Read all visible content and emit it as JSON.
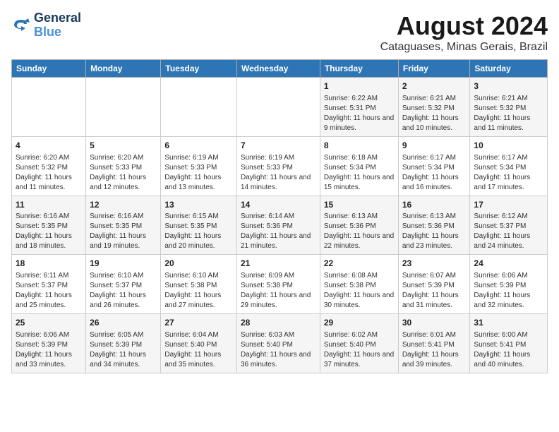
{
  "header": {
    "logo_line1": "General",
    "logo_line2": "Blue",
    "title": "August 2024",
    "subtitle": "Cataguases, Minas Gerais, Brazil"
  },
  "days_of_week": [
    "Sunday",
    "Monday",
    "Tuesday",
    "Wednesday",
    "Thursday",
    "Friday",
    "Saturday"
  ],
  "weeks": [
    [
      {
        "day": "",
        "info": ""
      },
      {
        "day": "",
        "info": ""
      },
      {
        "day": "",
        "info": ""
      },
      {
        "day": "",
        "info": ""
      },
      {
        "day": "1",
        "info": "Sunrise: 6:22 AM\nSunset: 5:31 PM\nDaylight: 11 hours and 9 minutes."
      },
      {
        "day": "2",
        "info": "Sunrise: 6:21 AM\nSunset: 5:32 PM\nDaylight: 11 hours and 10 minutes."
      },
      {
        "day": "3",
        "info": "Sunrise: 6:21 AM\nSunset: 5:32 PM\nDaylight: 11 hours and 11 minutes."
      }
    ],
    [
      {
        "day": "4",
        "info": "Sunrise: 6:20 AM\nSunset: 5:32 PM\nDaylight: 11 hours and 11 minutes."
      },
      {
        "day": "5",
        "info": "Sunrise: 6:20 AM\nSunset: 5:33 PM\nDaylight: 11 hours and 12 minutes."
      },
      {
        "day": "6",
        "info": "Sunrise: 6:19 AM\nSunset: 5:33 PM\nDaylight: 11 hours and 13 minutes."
      },
      {
        "day": "7",
        "info": "Sunrise: 6:19 AM\nSunset: 5:33 PM\nDaylight: 11 hours and 14 minutes."
      },
      {
        "day": "8",
        "info": "Sunrise: 6:18 AM\nSunset: 5:34 PM\nDaylight: 11 hours and 15 minutes."
      },
      {
        "day": "9",
        "info": "Sunrise: 6:17 AM\nSunset: 5:34 PM\nDaylight: 11 hours and 16 minutes."
      },
      {
        "day": "10",
        "info": "Sunrise: 6:17 AM\nSunset: 5:34 PM\nDaylight: 11 hours and 17 minutes."
      }
    ],
    [
      {
        "day": "11",
        "info": "Sunrise: 6:16 AM\nSunset: 5:35 PM\nDaylight: 11 hours and 18 minutes."
      },
      {
        "day": "12",
        "info": "Sunrise: 6:16 AM\nSunset: 5:35 PM\nDaylight: 11 hours and 19 minutes."
      },
      {
        "day": "13",
        "info": "Sunrise: 6:15 AM\nSunset: 5:35 PM\nDaylight: 11 hours and 20 minutes."
      },
      {
        "day": "14",
        "info": "Sunrise: 6:14 AM\nSunset: 5:36 PM\nDaylight: 11 hours and 21 minutes."
      },
      {
        "day": "15",
        "info": "Sunrise: 6:13 AM\nSunset: 5:36 PM\nDaylight: 11 hours and 22 minutes."
      },
      {
        "day": "16",
        "info": "Sunrise: 6:13 AM\nSunset: 5:36 PM\nDaylight: 11 hours and 23 minutes."
      },
      {
        "day": "17",
        "info": "Sunrise: 6:12 AM\nSunset: 5:37 PM\nDaylight: 11 hours and 24 minutes."
      }
    ],
    [
      {
        "day": "18",
        "info": "Sunrise: 6:11 AM\nSunset: 5:37 PM\nDaylight: 11 hours and 25 minutes."
      },
      {
        "day": "19",
        "info": "Sunrise: 6:10 AM\nSunset: 5:37 PM\nDaylight: 11 hours and 26 minutes."
      },
      {
        "day": "20",
        "info": "Sunrise: 6:10 AM\nSunset: 5:38 PM\nDaylight: 11 hours and 27 minutes."
      },
      {
        "day": "21",
        "info": "Sunrise: 6:09 AM\nSunset: 5:38 PM\nDaylight: 11 hours and 29 minutes."
      },
      {
        "day": "22",
        "info": "Sunrise: 6:08 AM\nSunset: 5:38 PM\nDaylight: 11 hours and 30 minutes."
      },
      {
        "day": "23",
        "info": "Sunrise: 6:07 AM\nSunset: 5:39 PM\nDaylight: 11 hours and 31 minutes."
      },
      {
        "day": "24",
        "info": "Sunrise: 6:06 AM\nSunset: 5:39 PM\nDaylight: 11 hours and 32 minutes."
      }
    ],
    [
      {
        "day": "25",
        "info": "Sunrise: 6:06 AM\nSunset: 5:39 PM\nDaylight: 11 hours and 33 minutes."
      },
      {
        "day": "26",
        "info": "Sunrise: 6:05 AM\nSunset: 5:39 PM\nDaylight: 11 hours and 34 minutes."
      },
      {
        "day": "27",
        "info": "Sunrise: 6:04 AM\nSunset: 5:40 PM\nDaylight: 11 hours and 35 minutes."
      },
      {
        "day": "28",
        "info": "Sunrise: 6:03 AM\nSunset: 5:40 PM\nDaylight: 11 hours and 36 minutes."
      },
      {
        "day": "29",
        "info": "Sunrise: 6:02 AM\nSunset: 5:40 PM\nDaylight: 11 hours and 37 minutes."
      },
      {
        "day": "30",
        "info": "Sunrise: 6:01 AM\nSunset: 5:41 PM\nDaylight: 11 hours and 39 minutes."
      },
      {
        "day": "31",
        "info": "Sunrise: 6:00 AM\nSunset: 5:41 PM\nDaylight: 11 hours and 40 minutes."
      }
    ]
  ]
}
